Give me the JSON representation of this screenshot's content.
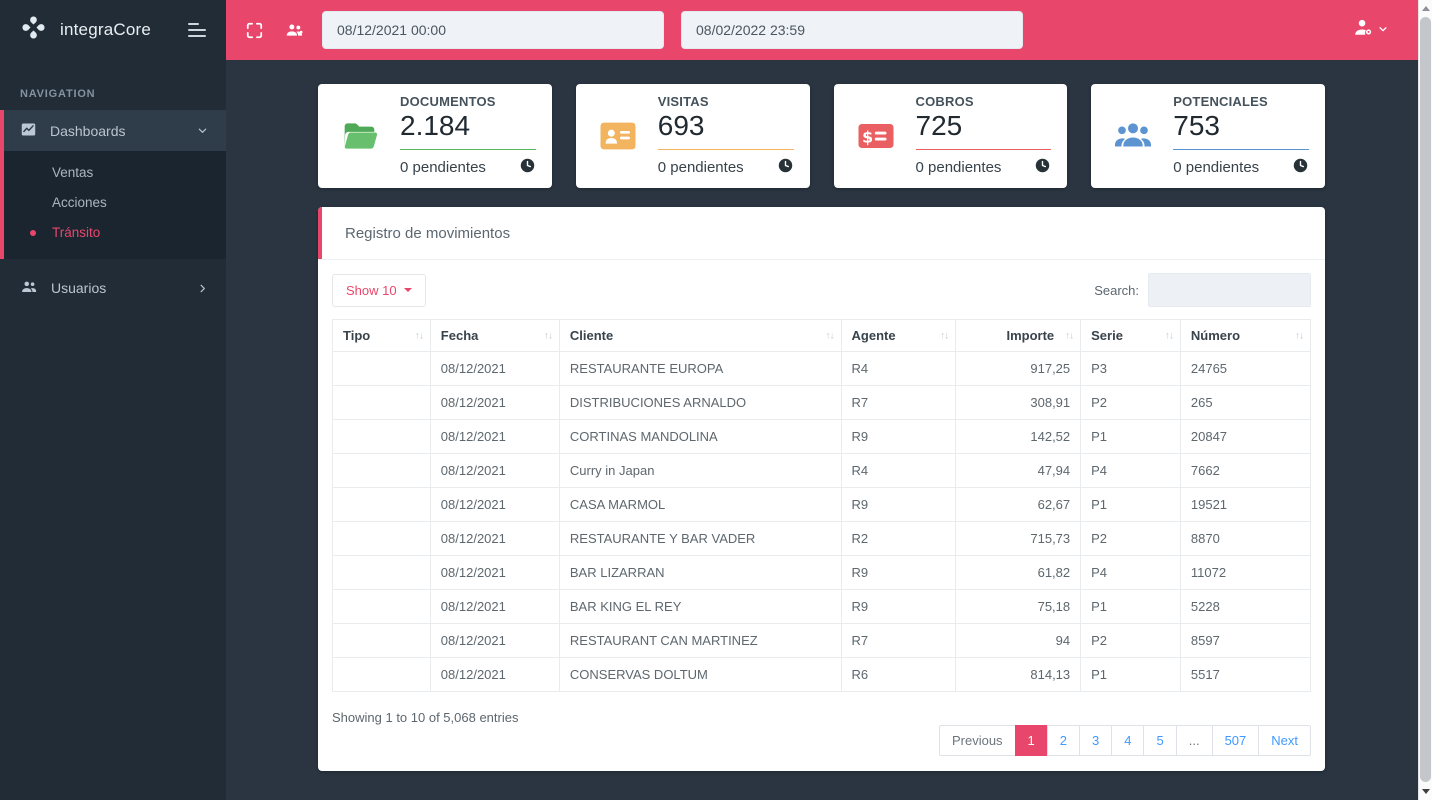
{
  "theme": {
    "accent_pink": "#e8476b",
    "link_blue": "#4099ff"
  },
  "brand": {
    "name": "integraCore"
  },
  "sidebar": {
    "section_label": "NAVIGATION",
    "dashboards": {
      "label": "Dashboards",
      "icon": "chart-icon",
      "expanded": true,
      "children": [
        "Ventas",
        "Acciones",
        "Tránsito"
      ],
      "active_child": "Tránsito"
    },
    "usuarios": {
      "label": "Usuarios",
      "icon": "users-icon"
    }
  },
  "topbar": {
    "date_from": "08/12/2021 00:00",
    "date_to": "08/02/2022 23:59"
  },
  "cards": [
    {
      "title": "DOCUMENTOS",
      "value": "2.184",
      "pending": "0 pendientes",
      "icon": "folder-open-icon",
      "color": "#5cb860"
    },
    {
      "title": "VISITAS",
      "value": "693",
      "pending": "0 pendientes",
      "icon": "id-card-icon",
      "color": "#f2b45f"
    },
    {
      "title": "COBROS",
      "value": "725",
      "pending": "0 pendientes",
      "icon": "money-check-icon",
      "color": "#ea5f62"
    },
    {
      "title": "POTENCIALES",
      "value": "753",
      "pending": "0 pendientes",
      "icon": "users-group-icon",
      "color": "#5b94d1"
    }
  ],
  "panel": {
    "title": "Registro de movimientos",
    "show_label": "Show 10",
    "search_label": "Search:",
    "table": {
      "columns": [
        {
          "key": "tipo",
          "label": "Tipo",
          "width": "10%"
        },
        {
          "key": "fecha",
          "label": "Fecha",
          "width": "13.2%"
        },
        {
          "key": "cliente",
          "label": "Cliente",
          "width": "28.8%"
        },
        {
          "key": "agente",
          "label": "Agente",
          "width": "11.7%"
        },
        {
          "key": "importe",
          "label": "Importe",
          "width": "12.8%",
          "align": "right"
        },
        {
          "key": "serie",
          "label": "Serie",
          "width": "10.2%"
        },
        {
          "key": "numero",
          "label": "Número",
          "width": "13.3%"
        }
      ],
      "rows": [
        {
          "tipo": "",
          "fecha": "08/12/2021",
          "cliente": "RESTAURANTE EUROPA",
          "agente": "R4",
          "importe": "917,25",
          "serie": "P3",
          "numero": "24765"
        },
        {
          "tipo": "",
          "fecha": "08/12/2021",
          "cliente": "DISTRIBUCIONES ARNALDO",
          "agente": "R7",
          "importe": "308,91",
          "serie": "P2",
          "numero": "265"
        },
        {
          "tipo": "",
          "fecha": "08/12/2021",
          "cliente": "CORTINAS MANDOLINA",
          "agente": "R9",
          "importe": "142,52",
          "serie": "P1",
          "numero": "20847"
        },
        {
          "tipo": "",
          "fecha": "08/12/2021",
          "cliente": "Curry in Japan",
          "agente": "R4",
          "importe": "47,94",
          "serie": "P4",
          "numero": "7662"
        },
        {
          "tipo": "",
          "fecha": "08/12/2021",
          "cliente": "CASA MARMOL",
          "agente": "R9",
          "importe": "62,67",
          "serie": "P1",
          "numero": "19521"
        },
        {
          "tipo": "",
          "fecha": "08/12/2021",
          "cliente": "RESTAURANTE Y BAR VADER",
          "agente": "R2",
          "importe": "715,73",
          "serie": "P2",
          "numero": "8870"
        },
        {
          "tipo": "",
          "fecha": "08/12/2021",
          "cliente": "BAR LIZARRAN",
          "agente": "R9",
          "importe": "61,82",
          "serie": "P4",
          "numero": "11072"
        },
        {
          "tipo": "",
          "fecha": "08/12/2021",
          "cliente": "BAR KING EL REY",
          "agente": "R9",
          "importe": "75,18",
          "serie": "P1",
          "numero": "5228"
        },
        {
          "tipo": "",
          "fecha": "08/12/2021",
          "cliente": "RESTAURANT CAN MARTINEZ",
          "agente": "R7",
          "importe": "94",
          "serie": "P2",
          "numero": "8597"
        },
        {
          "tipo": "",
          "fecha": "08/12/2021",
          "cliente": "CONSERVAS DOLTUM",
          "agente": "R6",
          "importe": "814,13",
          "serie": "P1",
          "numero": "5517"
        }
      ]
    },
    "summary": "Showing 1 to 10 of 5,068 entries",
    "pagination": [
      {
        "label": "Previous",
        "state": "disabled"
      },
      {
        "label": "1",
        "state": "active"
      },
      {
        "label": "2",
        "state": "link"
      },
      {
        "label": "3",
        "state": "link"
      },
      {
        "label": "4",
        "state": "link"
      },
      {
        "label": "5",
        "state": "link"
      },
      {
        "label": "...",
        "state": "ellipsis"
      },
      {
        "label": "507",
        "state": "link"
      },
      {
        "label": "Next",
        "state": "link"
      }
    ]
  }
}
